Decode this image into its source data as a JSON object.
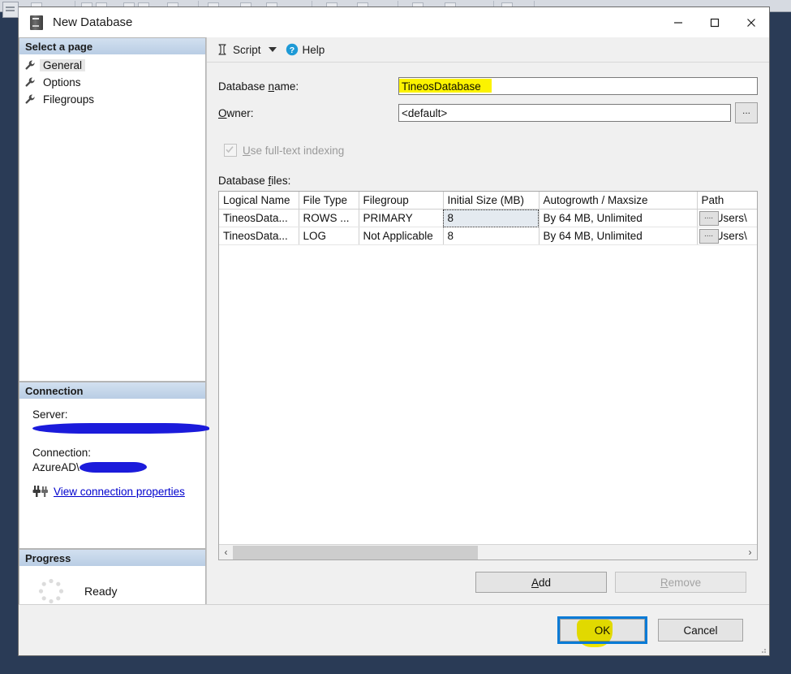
{
  "window": {
    "title": "New Database",
    "icon": "database-server-icon",
    "minimize_label": "—",
    "maximize_label": "□",
    "close_label": "✕"
  },
  "sidebar": {
    "pages_header": "Select a page",
    "pages": [
      {
        "label": "General",
        "icon": "wrench-icon",
        "selected": true
      },
      {
        "label": "Options",
        "icon": "wrench-icon",
        "selected": false
      },
      {
        "label": "Filegroups",
        "icon": "wrench-icon",
        "selected": false
      }
    ],
    "connection": {
      "header": "Connection",
      "server_label": "Server:",
      "server_value": "",
      "connection_label": "Connection:",
      "connection_value": "AzureAD\\",
      "view_properties_link": "View connection properties",
      "link_icon": "connection-plug-icon"
    },
    "progress": {
      "header": "Progress",
      "status": "Ready",
      "icon": "spinner-icon"
    }
  },
  "toolbar": {
    "script_label": "Script",
    "script_icon": "script-icon",
    "dropdown_icon": "chevron-down-icon",
    "help_label": "Help",
    "help_icon": "help-question-icon"
  },
  "form": {
    "database_name_label_pre": "Database ",
    "database_name_label_key": "n",
    "database_name_label_post": "ame:",
    "database_name_value": "TineosDatabase",
    "owner_label_key": "O",
    "owner_label_post": "wner:",
    "owner_value": "<default>",
    "owner_browse_label": "...",
    "fulltext_label_key": "U",
    "fulltext_label_post": "se full-text indexing",
    "fulltext_checked": true,
    "fulltext_disabled": true,
    "files_label_pre": "Database ",
    "files_label_key": "f",
    "files_label_post": "iles:"
  },
  "grid": {
    "columns": [
      "Logical Name",
      "File Type",
      "Filegroup",
      "Initial Size (MB)",
      "Autogrowth / Maxsize",
      "Path"
    ],
    "rows": [
      {
        "logical_name": "TineosData...",
        "file_type": "ROWS ...",
        "filegroup": "PRIMARY",
        "initial_size": "8",
        "autogrowth": "By 64 MB, Unlimited",
        "path_browse": "....",
        "path": "C:\\Users\\",
        "focused": true
      },
      {
        "logical_name": "TineosData...",
        "file_type": "LOG",
        "filegroup": "Not Applicable",
        "initial_size": "8",
        "autogrowth": "By 64 MB, Unlimited",
        "path_browse": "....",
        "path": "C:\\Users\\",
        "focused": false
      }
    ],
    "scroll_left_icon": "‹",
    "scroll_right_icon": "›"
  },
  "buttons": {
    "add_key": "A",
    "add_post": "dd",
    "remove_key": "R",
    "remove_post": "emove",
    "remove_disabled": true,
    "ok": "OK",
    "cancel": "Cancel"
  },
  "colors": {
    "desktop_background": "#2a3b56",
    "dialog_background": "#f0f0f0",
    "panel_header_top": "#d2e0f0",
    "panel_header_bottom": "#b9cde4",
    "highlight_yellow": "#fcf300",
    "focus_blue": "#0a7bd6",
    "redaction_blue": "#1b1bdb",
    "link_blue": "#0000cd",
    "help_icon_blue": "#1e9ad6",
    "cell_focus_fill": "#e4eaf0"
  }
}
